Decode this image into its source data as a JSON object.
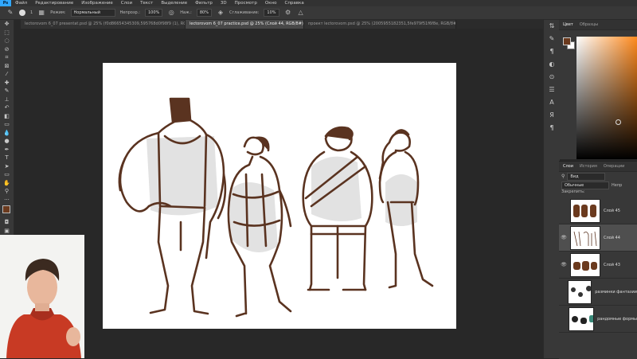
{
  "menu": [
    "Файл",
    "Редактирование",
    "Изображение",
    "Слои",
    "Текст",
    "Выделение",
    "Фильтр",
    "3D",
    "Просмотр",
    "Окно",
    "Справка"
  ],
  "options": {
    "brush_size": "1",
    "mode_label": "Режим:",
    "mode_value": "Нормальный",
    "opacity_label": "Непрозр.:",
    "opacity_value": "100%",
    "flow_label": "Наж.:",
    "flow_value": "80%",
    "smoothing_label": "Сглаживание:",
    "smoothing_value": "10%"
  },
  "tabs": [
    {
      "label": "lectorovom 6_07 presentat.psd @ 25% (f0d86654345309,595768d0f98f9 (1), RGB/8#) *",
      "active": false
    },
    {
      "label": "lectorovom 6_07 practice.psd @ 25% (Слой 44, RGB/8#) *",
      "active": true
    },
    {
      "label": "проект lectorovom.psd @ 25% (2005955182351,5fe979f51f6f8e, RGB/8#) *",
      "active": false
    }
  ],
  "color_panel": {
    "tab1": "Цвет",
    "tab2": "Образцы",
    "fg_color": "#6b3a1e",
    "bg_color": "#ffffff"
  },
  "layers_panel": {
    "tab1": "Слои",
    "tab2": "История",
    "tab3": "Операции",
    "filter_label": "Вид",
    "blend_mode": "Обычные",
    "opacity_short": "Непр",
    "lock_label": "Закрепить:",
    "layers": [
      {
        "name": "Слой 45",
        "visible": false,
        "selected": false
      },
      {
        "name": "Слой 44",
        "visible": true,
        "selected": true
      },
      {
        "name": "Слой 43",
        "visible": true,
        "selected": false
      },
      {
        "name": "разминки фантазии",
        "visible": false,
        "selected": false
      },
      {
        "name": "рандомные формы",
        "visible": false,
        "selected": false
      }
    ]
  },
  "colors": {
    "accent": "#31a8ff",
    "sketch": "#5a3320",
    "fill": "#e2e2e2"
  }
}
